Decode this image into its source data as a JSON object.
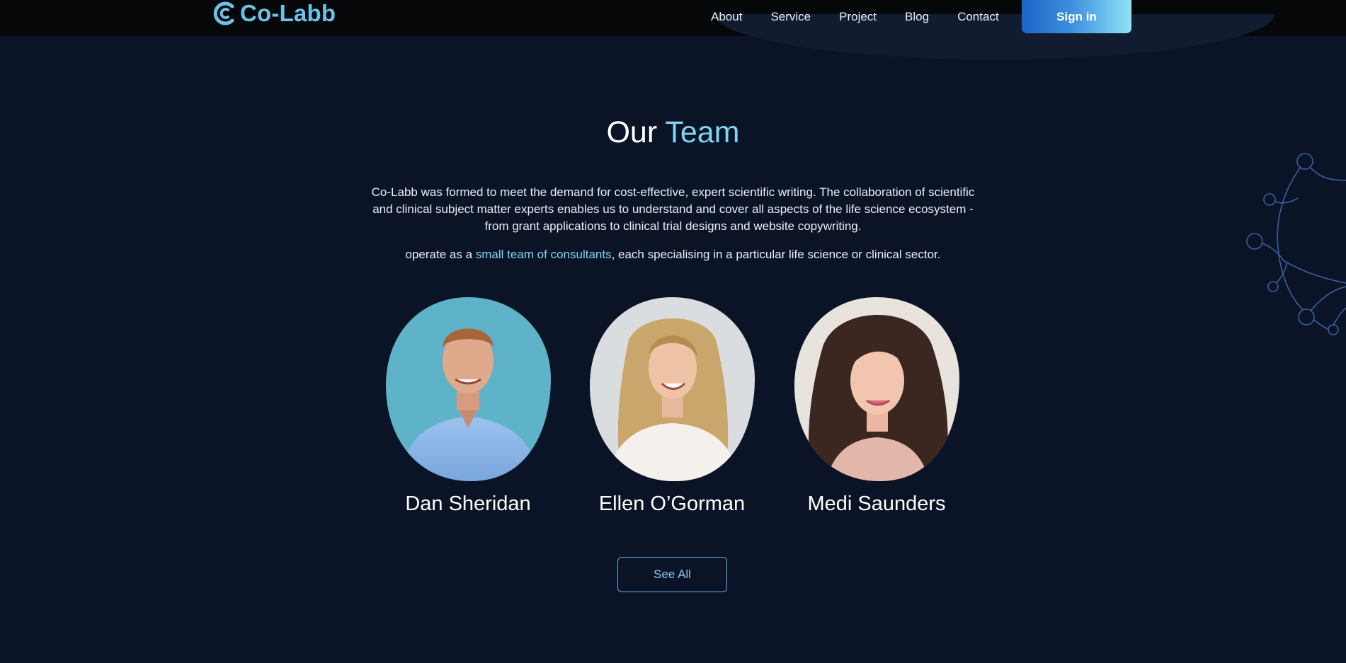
{
  "header": {
    "logo_text": "Co-Labb",
    "nav": [
      "About",
      "Service",
      "Project",
      "Blog",
      "Contact"
    ],
    "signin_label": "Sign in"
  },
  "team": {
    "title_plain": "Our",
    "title_accent": "Team",
    "intro": "Co-Labb was formed to meet the demand for cost-effective, expert scientific writing. The collaboration of scientific and clinical subject matter experts enables us to understand and cover all aspects of the life science ecosystem - from grant applications to clinical trial designs and website copywriting.",
    "intro2_before": "operate as a ",
    "intro2_link": "small team of consultants",
    "intro2_after": ", each specialising in a particular life science or clinical sector.",
    "members": [
      {
        "name": "Dan Sheridan"
      },
      {
        "name": "Ellen O’Gorman"
      },
      {
        "name": "Medi Saunders"
      }
    ],
    "see_all_label": "See All"
  },
  "colors": {
    "background": "#0b1426",
    "accent": "#7fd4f0",
    "logo": "#6cc2e6",
    "signin_gradient_start": "#1e64c8",
    "signin_gradient_end": "#8fe3f7"
  },
  "icons": {
    "logo": "co-labb-logo-icon",
    "decoration": "molecule-network-icon"
  }
}
